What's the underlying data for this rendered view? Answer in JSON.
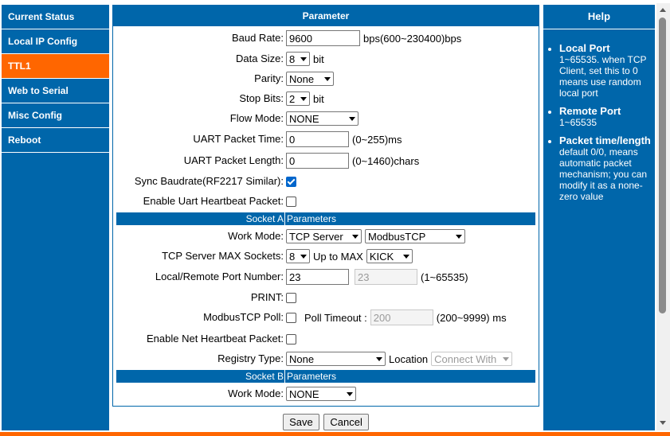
{
  "sidebar": {
    "items": [
      {
        "label": "Current Status"
      },
      {
        "label": "Local IP Config"
      },
      {
        "label": "TTL1"
      },
      {
        "label": "Web to Serial"
      },
      {
        "label": "Misc Config"
      },
      {
        "label": "Reboot"
      }
    ],
    "active_index": 2
  },
  "main": {
    "title": "Parameter",
    "baud_rate": {
      "label": "Baud Rate:",
      "value": "9600",
      "hint": "bps(600~230400)bps"
    },
    "data_size": {
      "label": "Data Size:",
      "value": "8",
      "unit": "bit"
    },
    "parity": {
      "label": "Parity:",
      "value": "None"
    },
    "stop_bits": {
      "label": "Stop Bits:",
      "value": "2",
      "unit": "bit"
    },
    "flow_mode": {
      "label": "Flow Mode:",
      "value": "NONE"
    },
    "uart_packet_time": {
      "label": "UART Packet Time:",
      "value": "0",
      "hint": "(0~255)ms"
    },
    "uart_packet_length": {
      "label": "UART Packet Length:",
      "value": "0",
      "hint": "(0~1460)chars"
    },
    "sync_baudrate": {
      "label": "Sync Baudrate(RF2217 Similar):",
      "checked": true
    },
    "uart_heartbeat": {
      "label": "Enable Uart Heartbeat Packet:",
      "checked": false
    },
    "socket_a": {
      "header_left": "Socket A",
      "header_right": "Parameters",
      "work_mode": {
        "label": "Work Mode:",
        "value": "TCP Server",
        "protocol": "ModbusTCP"
      },
      "max_sockets": {
        "label": "TCP Server MAX Sockets:",
        "value": "8",
        "up_to": "Up to MAX",
        "action": "KICK"
      },
      "port_number": {
        "label": "Local/Remote Port Number:",
        "local": "23",
        "remote": "23",
        "hint": "(1~65535)"
      },
      "print": {
        "label": "PRINT:",
        "checked": false
      },
      "modbus_poll": {
        "label": "ModbusTCP Poll:",
        "checked": false,
        "timeout_label": "Poll Timeout :",
        "timeout_value": "200",
        "hint": "(200~9999) ms"
      },
      "net_heartbeat": {
        "label": "Enable Net Heartbeat Packet:",
        "checked": false
      },
      "registry": {
        "label": "Registry Type:",
        "value": "None",
        "location_label": "Location",
        "location_value": "Connect With"
      }
    },
    "socket_b": {
      "header_left": "Socket B",
      "header_right": "Parameters",
      "work_mode": {
        "label": "Work Mode:",
        "value": "NONE"
      }
    },
    "save_label": "Save",
    "cancel_label": "Cancel"
  },
  "help": {
    "title": "Help",
    "items": [
      {
        "term": "Local Port",
        "text": "1~65535. when TCP Client, set this to 0 means use random local port"
      },
      {
        "term": "Remote Port",
        "text": "1~65535"
      },
      {
        "term": "Packet time/length",
        "text": "default 0/0, means automatic packet mechanism; you can modify it as a none-zero value"
      }
    ]
  },
  "colors": {
    "accent": "#0066aa",
    "active": "#ff6600"
  }
}
